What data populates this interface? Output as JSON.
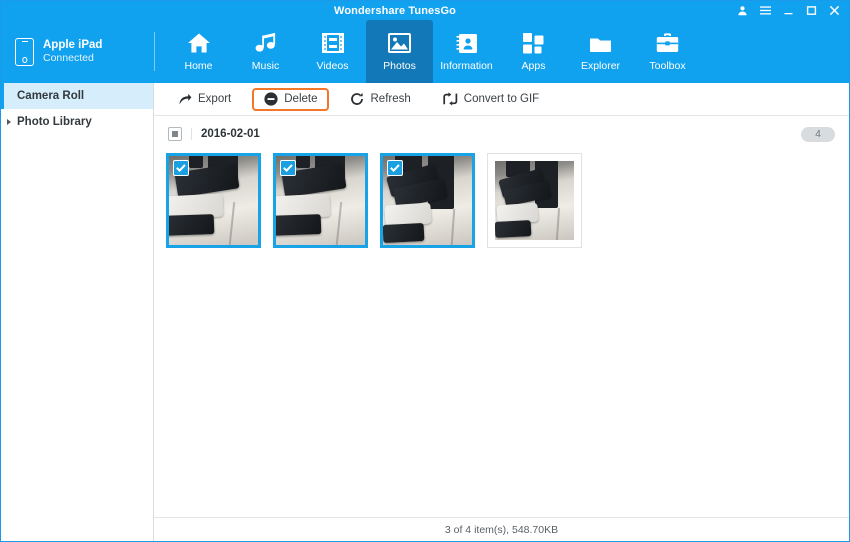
{
  "window": {
    "title": "Wondershare TunesGo",
    "controls": [
      {
        "name": "account-icon",
        "label": "Account"
      },
      {
        "name": "menu-icon",
        "label": "Menu"
      },
      {
        "name": "minimize-button",
        "label": "Minimize"
      },
      {
        "name": "maximize-button",
        "label": "Maximize"
      },
      {
        "name": "close-button",
        "label": "Close"
      }
    ]
  },
  "device": {
    "icon": "phone-icon",
    "name": "Apple iPad",
    "status": "Connected"
  },
  "nav": {
    "items": [
      {
        "label": "Home",
        "icon": "home-icon",
        "active": false
      },
      {
        "label": "Music",
        "icon": "music-note-icon",
        "active": false
      },
      {
        "label": "Videos",
        "icon": "film-strip-icon",
        "active": false
      },
      {
        "label": "Photos",
        "icon": "photo-icon",
        "active": true
      },
      {
        "label": "Information",
        "icon": "contact-card-icon",
        "active": false
      },
      {
        "label": "Apps",
        "icon": "grid-icon",
        "active": false
      },
      {
        "label": "Explorer",
        "icon": "folder-icon",
        "active": false
      },
      {
        "label": "Toolbox",
        "icon": "briefcase-icon",
        "active": false
      }
    ]
  },
  "sidebar": {
    "items": [
      {
        "label": "Camera Roll",
        "selected": true,
        "expandable": false
      },
      {
        "label": "Photo Library",
        "selected": false,
        "expandable": true
      }
    ]
  },
  "toolbar": {
    "buttons": [
      {
        "label": "Export",
        "icon": "export-arrow-icon",
        "highlighted": false
      },
      {
        "label": "Delete",
        "icon": "minus-circle-icon",
        "highlighted": true
      },
      {
        "label": "Refresh",
        "icon": "refresh-icon",
        "highlighted": false
      },
      {
        "label": "Convert to GIF",
        "icon": "convert-icon",
        "highlighted": false
      }
    ],
    "highlight_color": "#f4762a"
  },
  "album": {
    "checkbox_state": "partial",
    "date": "2016-02-01",
    "count": "4"
  },
  "photos": [
    {
      "name": "photo-thumbnail-1",
      "selected": true,
      "view": "close"
    },
    {
      "name": "photo-thumbnail-2",
      "selected": true,
      "view": "close"
    },
    {
      "name": "photo-thumbnail-3",
      "selected": true,
      "view": "wide"
    },
    {
      "name": "photo-thumbnail-4",
      "selected": false,
      "view": "wide"
    }
  ],
  "status": {
    "text": "3 of 4 item(s), 548.70KB"
  },
  "colors": {
    "brand_blue": "#11a2ef",
    "active_tab_blue": "#1278b7",
    "selection_blue": "#18a3e6",
    "highlight_orange": "#f4762a",
    "sidebar_selected_bg": "#d6eefb"
  }
}
